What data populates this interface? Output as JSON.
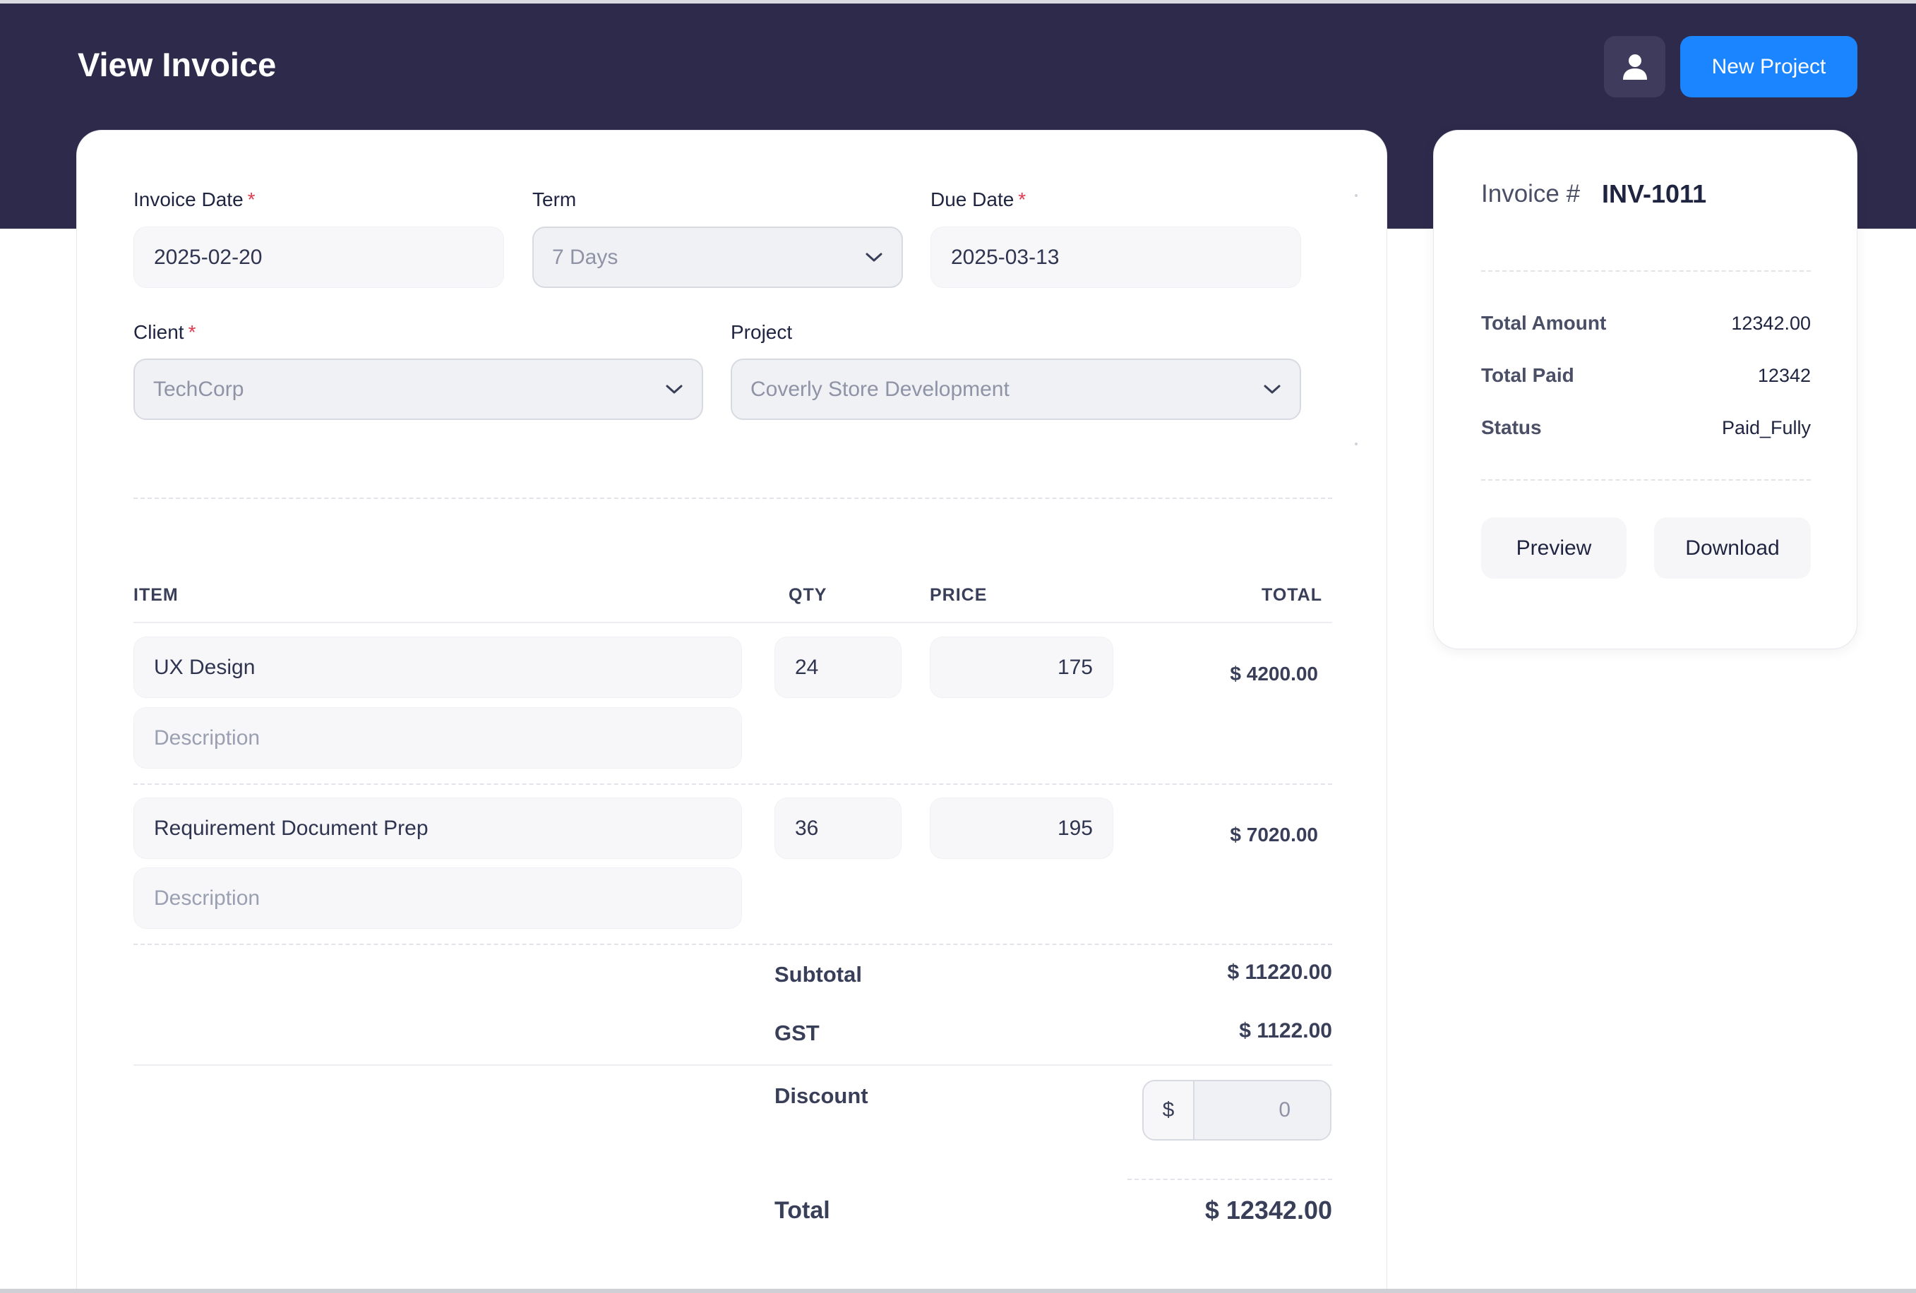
{
  "header": {
    "title": "View Invoice",
    "new_project_label": "New Project",
    "avatar_icon": "user-icon"
  },
  "form": {
    "invoice_date": {
      "label": "Invoice Date",
      "required": "*",
      "value": "2025-02-20"
    },
    "term": {
      "label": "Term",
      "value": "7 Days"
    },
    "due_date": {
      "label": "Due Date",
      "required": "*",
      "value": "2025-03-13"
    },
    "client": {
      "label": "Client",
      "required": "*",
      "value": "TechCorp"
    },
    "project": {
      "label": "Project",
      "value": "Coverly Store Development"
    }
  },
  "table": {
    "columns": [
      "ITEM",
      "QTY",
      "PRICE",
      "TOTAL"
    ],
    "rows": [
      {
        "item": "UX Design",
        "description": "Description",
        "qty": "24",
        "price": "175",
        "total": "$ 4200.00"
      },
      {
        "item": "Requirement Document Prep",
        "description": "Description",
        "qty": "36",
        "price": "195",
        "total": "$ 7020.00"
      }
    ]
  },
  "summary": {
    "subtotal_label": "Subtotal",
    "subtotal_value": "$ 11220.00",
    "gst_label": "GST",
    "gst_value": "$ 1122.00",
    "discount_label": "Discount",
    "discount_prefix": "$",
    "discount_placeholder": "0",
    "total_label": "Total",
    "total_value": "$ 12342.00"
  },
  "side": {
    "invoice_label": "Invoice #",
    "invoice_number": "INV-1011",
    "total_amount_label": "Total Amount",
    "total_amount_value": "12342.00",
    "total_paid_label": "Total Paid",
    "total_paid_value": "12342",
    "status_label": "Status",
    "status_value": "Paid_Fully",
    "preview_label": "Preview",
    "download_label": "Download"
  },
  "colors": {
    "header_bg": "#2e2a4b",
    "primary": "#1a85ff",
    "required": "#e23b4f"
  }
}
